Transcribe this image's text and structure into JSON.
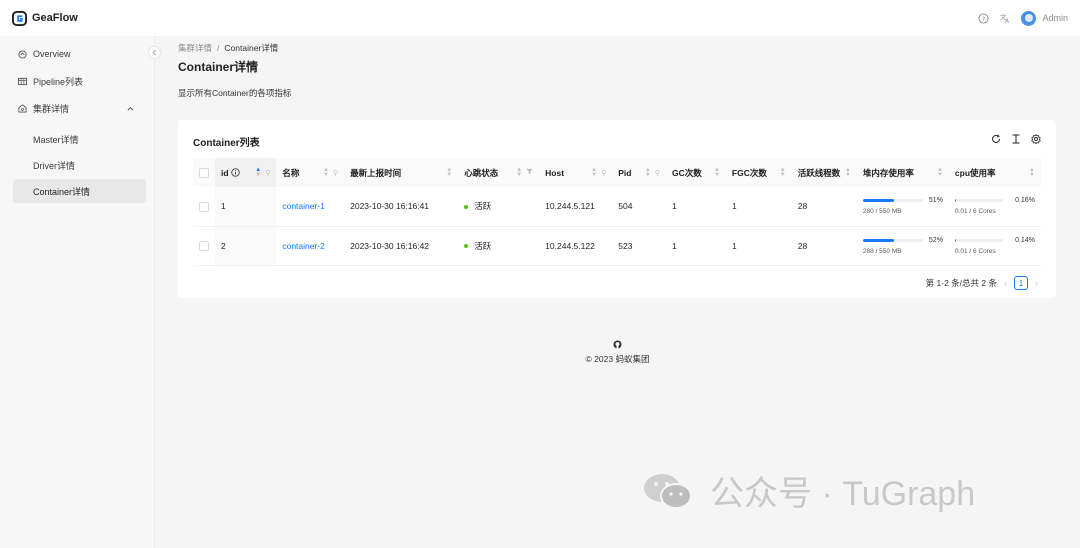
{
  "app": {
    "name": "GeaFlow",
    "user": "Admin"
  },
  "sidebar": {
    "items": [
      {
        "label": "Overview",
        "icon": "overview-icon"
      },
      {
        "label": "Pipeline列表",
        "icon": "table-icon"
      },
      {
        "label": "集群详情",
        "icon": "cluster-icon"
      }
    ],
    "subitems": [
      {
        "label": "Master详情"
      },
      {
        "label": "Driver详情"
      },
      {
        "label": "Container详情"
      }
    ]
  },
  "breadcrumb": {
    "parent": "集群详情",
    "sep": "/",
    "current": "Container详情"
  },
  "page": {
    "title": "Container详情",
    "desc": "显示所有Container的各项指标"
  },
  "card": {
    "title": "Container列表"
  },
  "table": {
    "headers": {
      "id": "id",
      "name": "名称",
      "last": "最新上报时间",
      "heartbeat": "心跳状态",
      "host": "Host",
      "pid": "Pid",
      "gc": "GC次数",
      "fgc": "FGC次数",
      "threads": "活跃线程数",
      "heap": "堆内存使用率",
      "cpu": "cpu使用率"
    },
    "rows": [
      {
        "id": "1",
        "name": "container-1",
        "last": "2023-10-30 16:16:41",
        "heartbeat": "活跃",
        "host": "10.244.5.121",
        "pid": "504",
        "gc": "1",
        "fgc": "1",
        "threads": "28",
        "heap_pct": "51%",
        "heap_val": 51,
        "heap_sub": "280 / 550 MB",
        "cpu_pct": "0.16%",
        "cpu_val": 0.16,
        "cpu_sub": "0.01 / 6 Cores"
      },
      {
        "id": "2",
        "name": "container-2",
        "last": "2023-10-30 16:16:42",
        "heartbeat": "活跃",
        "host": "10.244.5.122",
        "pid": "523",
        "gc": "1",
        "fgc": "1",
        "threads": "28",
        "heap_pct": "52%",
        "heap_val": 52,
        "heap_sub": "288 / 550 MB",
        "cpu_pct": "0.14%",
        "cpu_val": 0.14,
        "cpu_sub": "0.01 / 6 Cores"
      }
    ]
  },
  "pagination": {
    "summary": "第 1-2 条/总共 2 条",
    "current": "1"
  },
  "footer": {
    "copyright": "© 2023 蚂蚁集团"
  },
  "watermark": {
    "text": "公众号 · TuGraph"
  },
  "colors": {
    "accent": "#1677ff",
    "success": "#52c41a"
  }
}
